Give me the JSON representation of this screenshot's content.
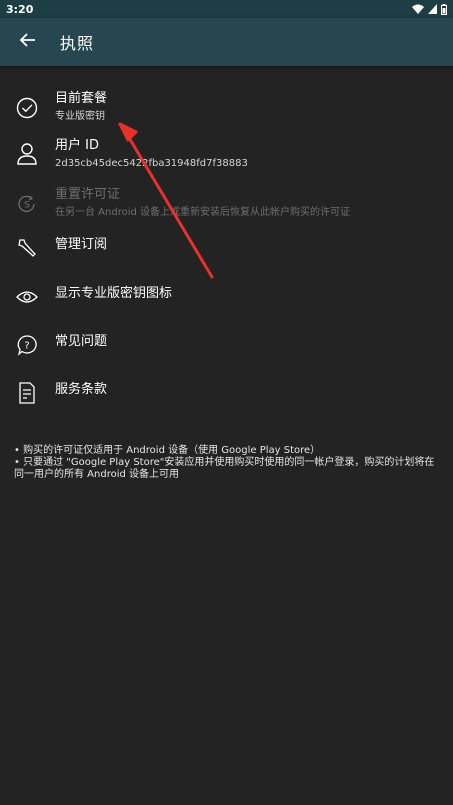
{
  "status_bar": {
    "time": "3:20",
    "icons": [
      "wifi-icon",
      "signal-icon",
      "battery-icon"
    ]
  },
  "app_bar": {
    "title": "执照",
    "back_icon": "arrow-back-icon"
  },
  "menu": [
    {
      "icon": "check-circle-icon",
      "title": "目前套餐",
      "subtitle": "专业版密钥",
      "enabled": true
    },
    {
      "icon": "person-icon",
      "title": "用户 ID",
      "subtitle": "2d35cb45dec5422fba31948fd7f38883",
      "enabled": true
    },
    {
      "icon": "restore-icon",
      "title": "重置许可证",
      "subtitle": "在另一台 Android 设备上或重新安装后恢复从此帐户购买的许可证",
      "enabled": false
    },
    {
      "icon": "wrench-icon",
      "title": "管理订阅",
      "subtitle": "",
      "enabled": true
    },
    {
      "icon": "eye-icon",
      "title": "显示专业版密钥图标",
      "subtitle": "",
      "enabled": true
    },
    {
      "icon": "help-bubble-icon",
      "title": "常见问题",
      "subtitle": "",
      "enabled": true
    },
    {
      "icon": "document-icon",
      "title": "服务条款",
      "subtitle": "",
      "enabled": true
    }
  ],
  "notes": {
    "line1": "• 购买的许可证仅适用于 Android 设备（使用 Google Play Store）",
    "line2": "• 只要通过 \"Google Play Store\"安装应用并使用购买时使用的同一帐户登录，购买的计划将在同一用户的所有 Android 设备上可用"
  },
  "colors": {
    "background": "#232323",
    "app_bar": "#264750",
    "status_bar": "#1e3d44",
    "annotation_arrow": "#e8312a",
    "disabled_text": "#6e6e6e"
  }
}
